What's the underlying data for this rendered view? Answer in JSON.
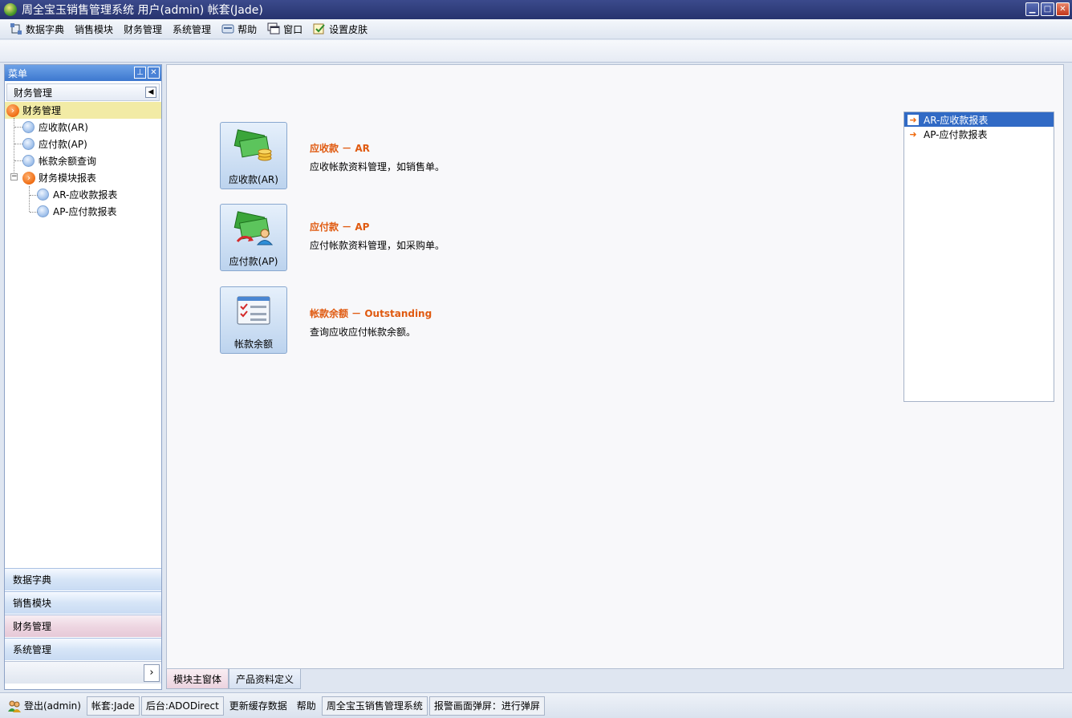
{
  "window": {
    "title": "周全宝玉销售管理系统 用户(admin) 帐套(Jade)"
  },
  "menubar": [
    {
      "label": "数据字典",
      "icon": "data-dictionary-icon"
    },
    {
      "label": "销售模块"
    },
    {
      "label": "财务管理"
    },
    {
      "label": "系统管理"
    },
    {
      "label": "帮助",
      "icon": "help-icon"
    },
    {
      "label": "窗口",
      "icon": "window-icon"
    },
    {
      "label": "设置皮肤",
      "icon": "skin-icon"
    }
  ],
  "sidebar": {
    "header": "菜单",
    "group": "财务管理",
    "tree": {
      "root": "财务管理",
      "items": [
        "应收款(AR)",
        "应付款(AP)",
        "帐款余额查询"
      ],
      "subgroup": "财务模块报表",
      "subitems": [
        "AR-应收款报表",
        "AP-应付款报表"
      ]
    },
    "nav_groups": [
      "数据字典",
      "销售模块",
      "财务管理",
      "系统管理"
    ],
    "active_nav": "财务管理"
  },
  "main": {
    "modules": [
      {
        "button": "应收款(AR)",
        "title": "应收款 － AR",
        "text": "应收帐款资料管理，如销售单。"
      },
      {
        "button": "应付款(AP)",
        "title": "应付款 － AP",
        "text": "应付帐款资料管理，如采购单。"
      },
      {
        "button": "帐款余额",
        "title": "帐款余额 － Outstanding",
        "text": "查询应收应付帐款余额。"
      }
    ],
    "reports": [
      "AR-应收款报表",
      "AP-应付款报表"
    ]
  },
  "tabs": [
    "模块主窗体",
    "产品资料定义"
  ],
  "statusbar": {
    "logout": "登出(admin)",
    "account": "帐套:Jade",
    "backend": "后台:ADODirect",
    "refresh": "更新缓存数据",
    "help": "帮助",
    "system": "周全宝玉销售管理系统",
    "alert": "报警画面弹屏：进行弹屏"
  }
}
